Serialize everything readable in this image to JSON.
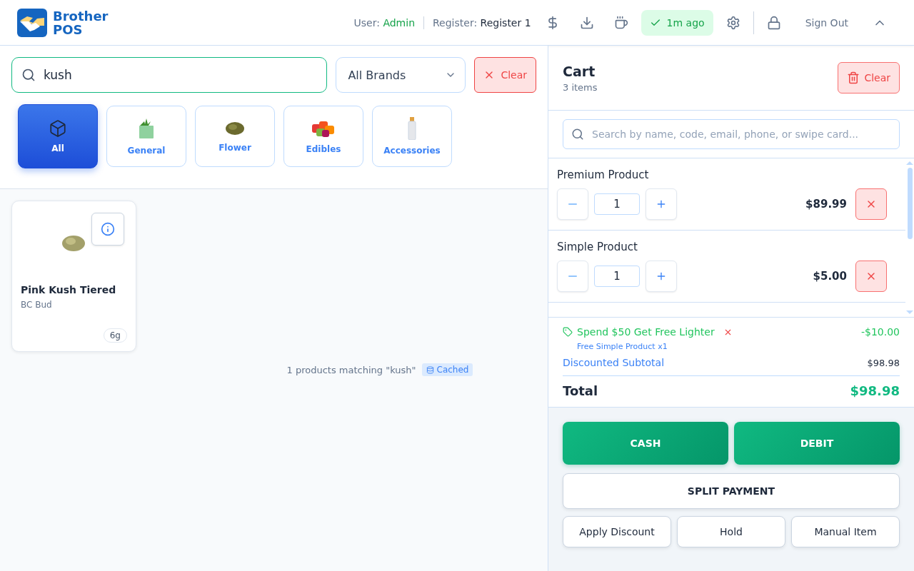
{
  "header": {
    "brand": [
      "Brother",
      "POS"
    ],
    "user_label": "User:",
    "user": "Admin",
    "register_label": "Register:",
    "register": "Register 1",
    "sync": "1m ago",
    "sign_out": "Sign Out"
  },
  "filters": {
    "search": "kush",
    "brand": "All Brands",
    "clear": "Clear"
  },
  "categories": [
    {
      "label": "All",
      "kind": "all",
      "selected": true
    },
    {
      "label": "General",
      "kind": "bag",
      "selected": false
    },
    {
      "label": "Flower",
      "kind": "bud",
      "selected": false
    },
    {
      "label": "Edibles",
      "kind": "gummies",
      "selected": false
    },
    {
      "label": "Accessories",
      "kind": "lighter",
      "selected": false
    }
  ],
  "products": [
    {
      "name": "Pink Kush Tiered",
      "brand": "BC Bud",
      "size": "6g"
    }
  ],
  "result_text": "1 products matching \"kush\"",
  "cache_badge": "Cached",
  "cart": {
    "title": "Cart",
    "count": "3 items",
    "clear": "Clear",
    "search_placeholder": "Search by name, code, email, phone, or swipe card...",
    "items": [
      {
        "name": "Premium Product",
        "qty": "1",
        "price": "$89.99"
      },
      {
        "name": "Simple Product",
        "qty": "1",
        "price": "$5.00"
      }
    ],
    "promo": {
      "name": "Spend $50 Get Free Lighter",
      "amount": "-$10.00",
      "detail": "Free Simple Product x1"
    },
    "subtotal_label": "Discounted Subtotal",
    "subtotal": "$98.98",
    "total_label": "Total",
    "total": "$98.98"
  },
  "payments": [
    {
      "label": "CASH",
      "kind": "primary"
    },
    {
      "label": "DEBIT",
      "kind": "primary"
    },
    {
      "label": "SPLIT PAYMENT",
      "kind": "wide"
    }
  ],
  "actions": [
    "Apply Discount",
    "Hold",
    "Manual Item"
  ]
}
